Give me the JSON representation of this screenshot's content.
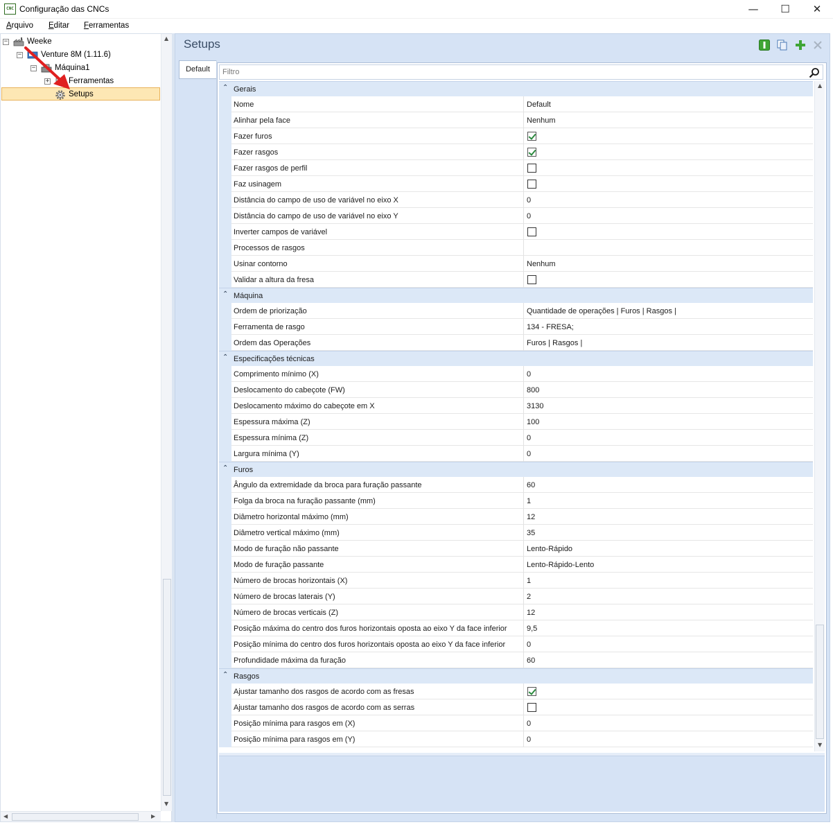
{
  "window": {
    "title": "Configuração das CNCs",
    "app_icon_text": "CNC",
    "minimize_glyph": "—",
    "maximize_glyph": "☐",
    "close_glyph": "✕"
  },
  "menu": {
    "items": [
      "Arquivo",
      "Editar",
      "Ferramentas"
    ]
  },
  "tree": {
    "nodes": [
      {
        "label": "Weeke",
        "toggle": "−",
        "icon": "factory-icon"
      },
      {
        "label": "Venture 8M (1.11.6)",
        "toggle": "−",
        "icon": "machine-icon"
      },
      {
        "label": "Máquina1",
        "toggle": "−",
        "icon": "machine-unit-icon"
      },
      {
        "label": "Ferramentas",
        "toggle": "+",
        "icon": "tools-icon"
      },
      {
        "label": "Setups",
        "icon": "gear-icon",
        "selected": true
      }
    ]
  },
  "panel": {
    "title": "Setups",
    "tab_label": "Default",
    "filter_placeholder": "Filtro"
  },
  "categories": [
    {
      "label": "Gerais",
      "rows": [
        {
          "name": "Nome",
          "value": "Default"
        },
        {
          "name": "Alinhar pela face",
          "value": "Nenhum"
        },
        {
          "name": "Fazer furos",
          "checked": true
        },
        {
          "name": "Fazer rasgos",
          "checked": true
        },
        {
          "name": "Fazer rasgos de perfil",
          "checked": false
        },
        {
          "name": "Faz usinagem",
          "checked": false
        },
        {
          "name": "Distância do campo de uso de variável no eixo X",
          "value": "0"
        },
        {
          "name": "Distância do campo de uso de variável no eixo Y",
          "value": "0"
        },
        {
          "name": "Inverter campos de variável",
          "checked": false
        },
        {
          "name": "Processos de rasgos",
          "value": ""
        },
        {
          "name": "Usinar contorno",
          "value": "Nenhum"
        },
        {
          "name": "Validar a altura da fresa",
          "checked": false
        }
      ]
    },
    {
      "label": "Máquina",
      "rows": [
        {
          "name": "Ordem de priorização",
          "value": "Quantidade de operações | Furos | Rasgos |"
        },
        {
          "name": "Ferramenta de rasgo",
          "value": "134 - FRESA;"
        },
        {
          "name": "Ordem das Operações",
          "value": "Furos | Rasgos |"
        }
      ]
    },
    {
      "label": "Especificações técnicas",
      "rows": [
        {
          "name": "Comprimento mínimo (X)",
          "value": "0"
        },
        {
          "name": "Deslocamento do cabeçote (FW)",
          "value": "800"
        },
        {
          "name": "Deslocamento máximo do cabeçote em X",
          "value": "3130"
        },
        {
          "name": "Espessura máxima (Z)",
          "value": "100"
        },
        {
          "name": "Espessura mínima (Z)",
          "value": "0"
        },
        {
          "name": "Largura mínima (Y)",
          "value": "0"
        }
      ]
    },
    {
      "label": "Furos",
      "rows": [
        {
          "name": "Ângulo da extremidade da broca para furação passante",
          "value": "60"
        },
        {
          "name": "Folga da broca na furação passante (mm)",
          "value": "1"
        },
        {
          "name": "Diâmetro horizontal máximo (mm)",
          "value": "12"
        },
        {
          "name": "Diâmetro vertical máximo (mm)",
          "value": "35"
        },
        {
          "name": "Modo de furação não passante",
          "value": "Lento-Rápido"
        },
        {
          "name": "Modo de furação passante",
          "value": "Lento-Rápido-Lento"
        },
        {
          "name": "Número de brocas horizontais (X)",
          "value": "1"
        },
        {
          "name": "Número de brocas laterais (Y)",
          "value": "2"
        },
        {
          "name": "Número de brocas verticais (Z)",
          "value": "12"
        },
        {
          "name": "Posição máxima do centro dos furos horizontais oposta ao eixo Y da face inferior",
          "value": "9,5"
        },
        {
          "name": "Posição mínima do centro dos furos horizontais oposta ao eixo Y da face inferior",
          "value": "0"
        },
        {
          "name": "Profundidade máxima da furação",
          "value": "60"
        }
      ]
    },
    {
      "label": "Rasgos",
      "rows": [
        {
          "name": "Ajustar tamanho dos rasgos de acordo com as fresas",
          "checked": true
        },
        {
          "name": "Ajustar tamanho dos rasgos de acordo com as serras",
          "checked": false
        },
        {
          "name": "Posição mínima para rasgos em (X)",
          "value": "0"
        },
        {
          "name": "Posição mínima para rasgos em (Y)",
          "value": "0"
        }
      ]
    }
  ],
  "colors": {
    "panel_bg": "#d6e3f5",
    "category_bg": "#dce8f7",
    "selection_bg": "#fde7b4",
    "selection_border": "#e9b35b",
    "check_green": "#2b8a3e",
    "toolbar_green": "#3fa535",
    "annotation_arrow": "#e02020"
  }
}
